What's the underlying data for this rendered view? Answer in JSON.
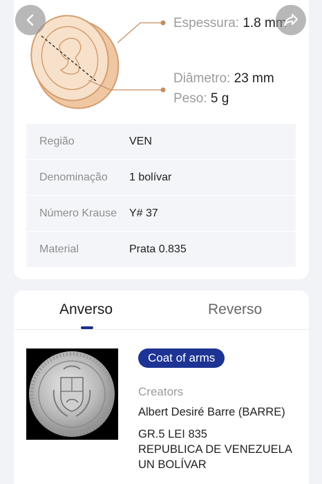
{
  "specs": {
    "thickness_label": "Espessura:",
    "thickness_value": "1.8 mm",
    "diameter_label": "Diâmetro:",
    "diameter_value": "23 mm",
    "weight_label": "Peso:",
    "weight_value": "5 g"
  },
  "details": [
    {
      "label": "Região",
      "value": "VEN"
    },
    {
      "label": "Denominação",
      "value": "1 bolívar"
    },
    {
      "label": "Número Krause",
      "value": "Y# 37"
    },
    {
      "label": "Material",
      "value": "Prata 0.835"
    }
  ],
  "tabs": {
    "obverse": "Anverso",
    "reverse": "Reverso"
  },
  "obverse": {
    "badge": "Coat of arms",
    "creators_label": "Creators",
    "creators_value": "Albert Desiré Barre (BARRE)",
    "lines": [
      "GR.5 LEI 835",
      "REPUBLICA DE VENEZUELA",
      "UN BOLÍVAR"
    ]
  },
  "colors": {
    "accent": "#1d3494",
    "coin_outline": "#d5a070",
    "coin_fill": "#f6ddc6"
  },
  "icons": {
    "back": "chevron-left-icon",
    "share": "share-arrow-icon"
  }
}
